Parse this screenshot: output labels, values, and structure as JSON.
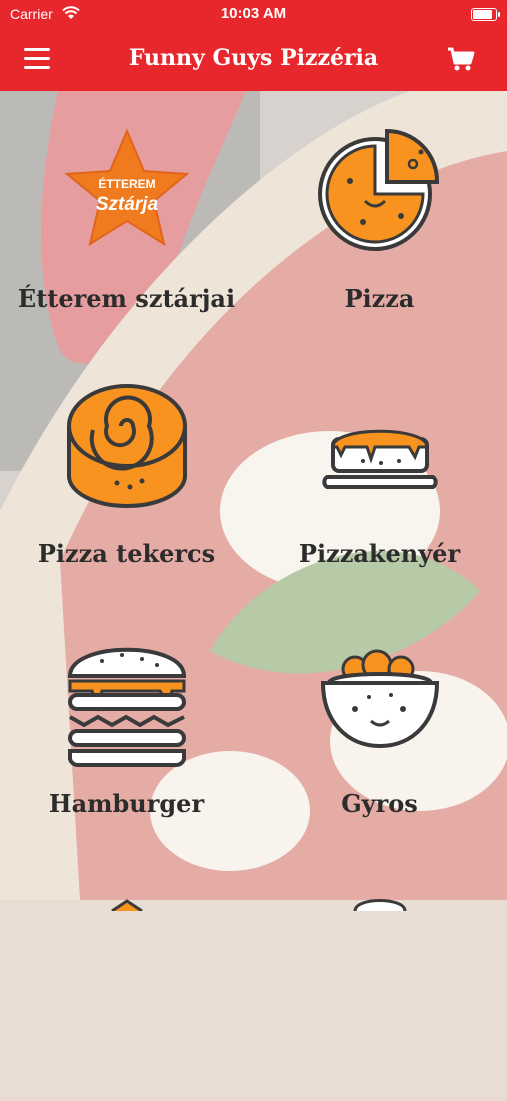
{
  "status_bar": {
    "carrier": "Carrier",
    "time": "10:03 AM",
    "battery_level": 0.95
  },
  "nav": {
    "title": "Funny Guys Pizzéria",
    "menu_icon": "hamburger-menu-icon",
    "cart_icon": "shopping-cart-icon"
  },
  "categories": [
    {
      "label": "Étterem sztárjai",
      "icon": "star-badge-icon",
      "badge_line1": "ÉTTEREM",
      "badge_line2": "Sztárja"
    },
    {
      "label": "Pizza",
      "icon": "pizza-icon"
    },
    {
      "label": "Pizza tekercs",
      "icon": "pizza-roll-icon"
    },
    {
      "label": "Pizzakenyér",
      "icon": "pizza-bread-icon"
    },
    {
      "label": "Hamburger",
      "icon": "hamburger-icon"
    },
    {
      "label": "Gyros",
      "icon": "gyros-bowl-icon"
    }
  ],
  "colors": {
    "brand_red": "#e8272c",
    "icon_orange": "#f7931e",
    "icon_stroke": "#3a3a3a"
  }
}
